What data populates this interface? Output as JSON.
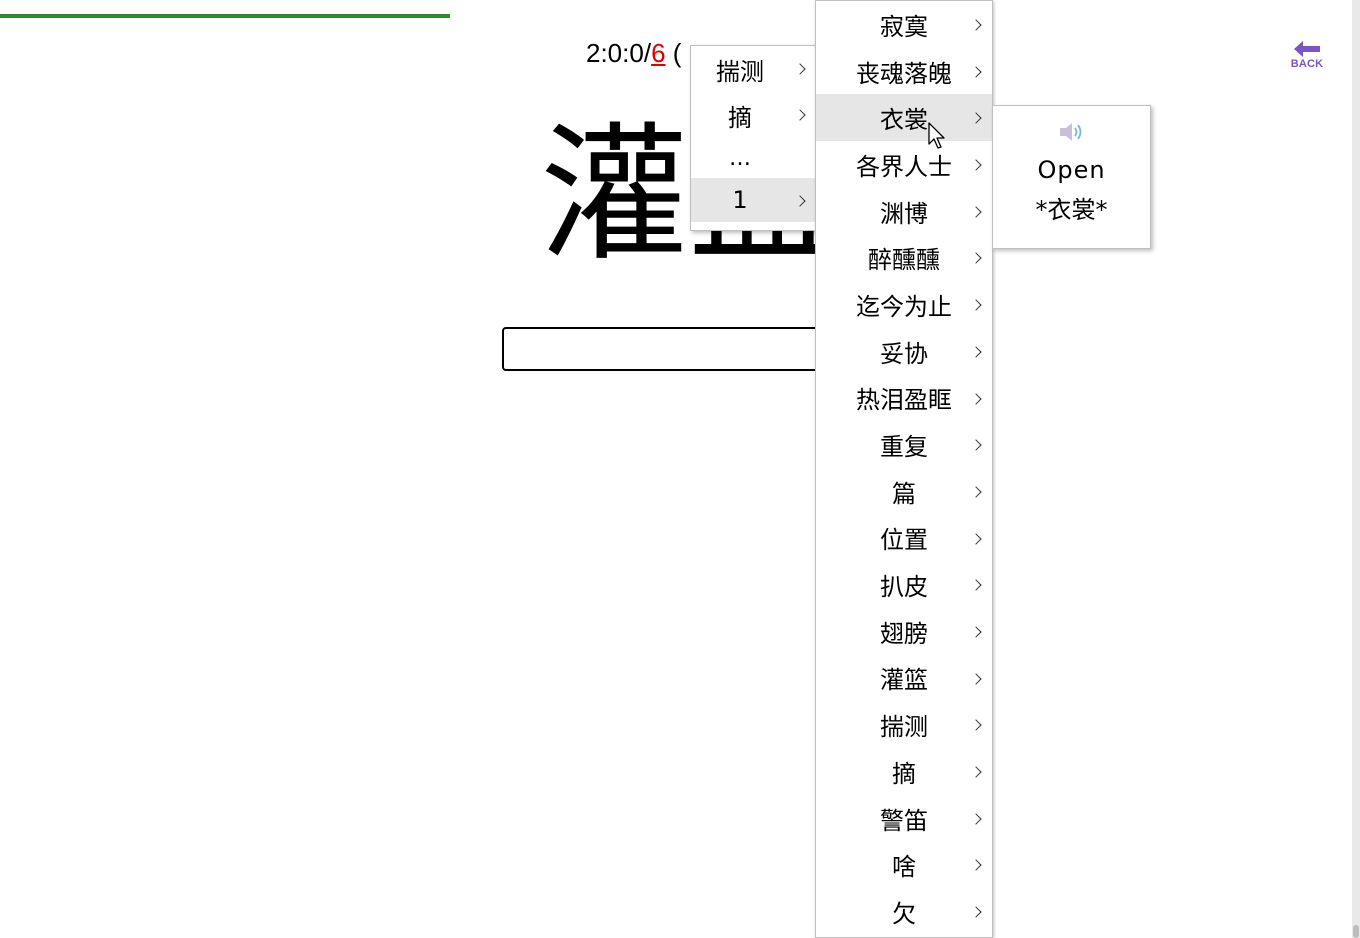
{
  "progress": {
    "fraction": 0.333
  },
  "score": {
    "prefix": "2:0:0/",
    "wrong": "6",
    "suffix": " ("
  },
  "back": {
    "label": "BACK",
    "color": "#7b55c4"
  },
  "question": {
    "word": "灌篮"
  },
  "answer": {
    "value": ""
  },
  "submenu_left": {
    "items": [
      {
        "label": "揣测",
        "has_arrow": true
      },
      {
        "label": "摘",
        "has_arrow": true
      },
      {
        "label": "…",
        "has_arrow": false
      },
      {
        "label": "1",
        "has_arrow": true,
        "active": true
      }
    ]
  },
  "word_menu": {
    "items": [
      {
        "label": "寂寞"
      },
      {
        "label": "丧魂落魄"
      },
      {
        "label": "衣裳",
        "active": true
      },
      {
        "label": "各界人士"
      },
      {
        "label": "渊博"
      },
      {
        "label": "醉醺醺"
      },
      {
        "label": "迄今为止"
      },
      {
        "label": "妥协"
      },
      {
        "label": "热泪盈眶"
      },
      {
        "label": "重复"
      },
      {
        "label": "篇"
      },
      {
        "label": "位置"
      },
      {
        "label": "扒皮"
      },
      {
        "label": "翅膀"
      },
      {
        "label": "灌篮"
      },
      {
        "label": "揣测"
      },
      {
        "label": "摘"
      },
      {
        "label": "警笛"
      },
      {
        "label": "啥"
      },
      {
        "label": "欠"
      }
    ]
  },
  "popup": {
    "icon": "speaker-icon",
    "open_label": "Open",
    "word_label": "*衣裳*"
  },
  "colors": {
    "progress": "#2e8b2e",
    "wrong": "#e00000",
    "active_row": "#e6e6e6"
  }
}
